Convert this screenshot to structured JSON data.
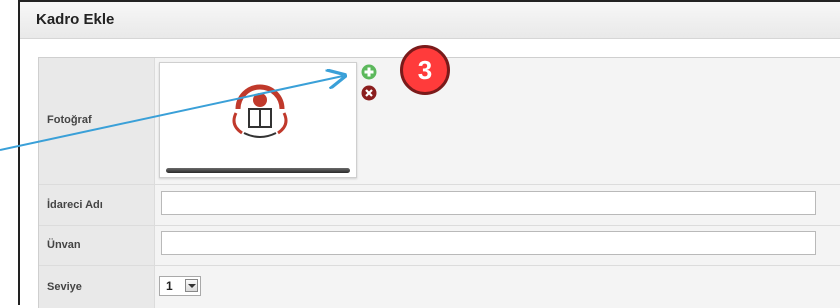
{
  "window": {
    "title": "Kadro Ekle"
  },
  "form": {
    "photo_label": "Fotoğraf",
    "name_label": "İdareci Adı",
    "name_value": "",
    "title_label": "Ünvan",
    "title_value": "",
    "level_label": "Seviye",
    "level_value": "1"
  },
  "annotation": {
    "step_number": "3"
  },
  "colors": {
    "add_icon": "#5cb85c",
    "remove_icon": "#8b1e1e",
    "arrow": "#3aa0d8",
    "badge": "#ff3b3b"
  },
  "icons": {
    "add": "plus-circle-icon",
    "remove": "x-circle-icon",
    "photo": "meb-logo-icon"
  }
}
